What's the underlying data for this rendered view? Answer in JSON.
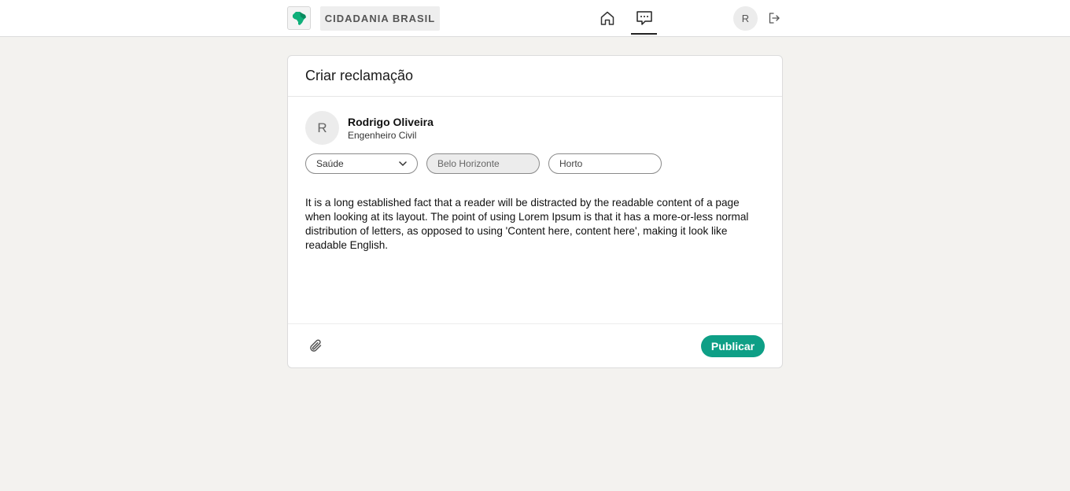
{
  "header": {
    "brand_label": "CIDADANIA BRASIL",
    "logo_icon": "brazil-map-icon",
    "nav": [
      {
        "icon": "home-icon",
        "active": false
      },
      {
        "icon": "chat-icon",
        "active": true
      }
    ],
    "avatar_initial": "R",
    "logout_icon": "logout-icon"
  },
  "card": {
    "title": "Criar reclamação",
    "user": {
      "avatar_initial": "R",
      "name": "Rodrigo Oliveira",
      "role": "Engenheiro Civil"
    },
    "category_select": {
      "selected": "Saúde"
    },
    "city_field": {
      "value": "Belo Horizonte"
    },
    "district_field": {
      "value": "Horto"
    },
    "body": "It is a long established fact that a reader will be distracted by the readable content of a page when looking at its layout. The point of using Lorem Ipsum is that it has a more-or-less normal distribution of letters, as opposed to using 'Content here, content here', making it look like readable English.",
    "attach_icon": "paperclip-icon",
    "publish_label": "Publicar"
  },
  "colors": {
    "accent": "#0e9f86",
    "background": "#f3f2ef",
    "spell_underline": "#e03030"
  }
}
